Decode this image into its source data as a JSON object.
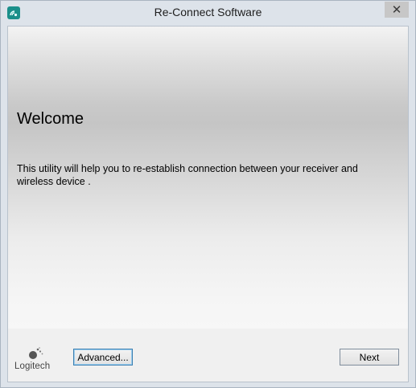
{
  "window": {
    "title": "Re-Connect Software",
    "close_glyph": "✕"
  },
  "banner": {
    "heading": "Welcome",
    "description": "This utility will help you to re-establish connection between your receiver and wireless device ."
  },
  "footer": {
    "logo_text": "Logitech",
    "advanced_label": "Advanced...",
    "next_label": "Next"
  },
  "icons": {
    "app": "logitech-connect-app-icon",
    "logo": "logitech-logo-icon",
    "close": "close-icon"
  },
  "colors": {
    "titlebar": "#dde3ea",
    "app_icon": "#1a8f8a",
    "close_button": "#c7c7c7",
    "focus_border": "#3c7fb1"
  }
}
